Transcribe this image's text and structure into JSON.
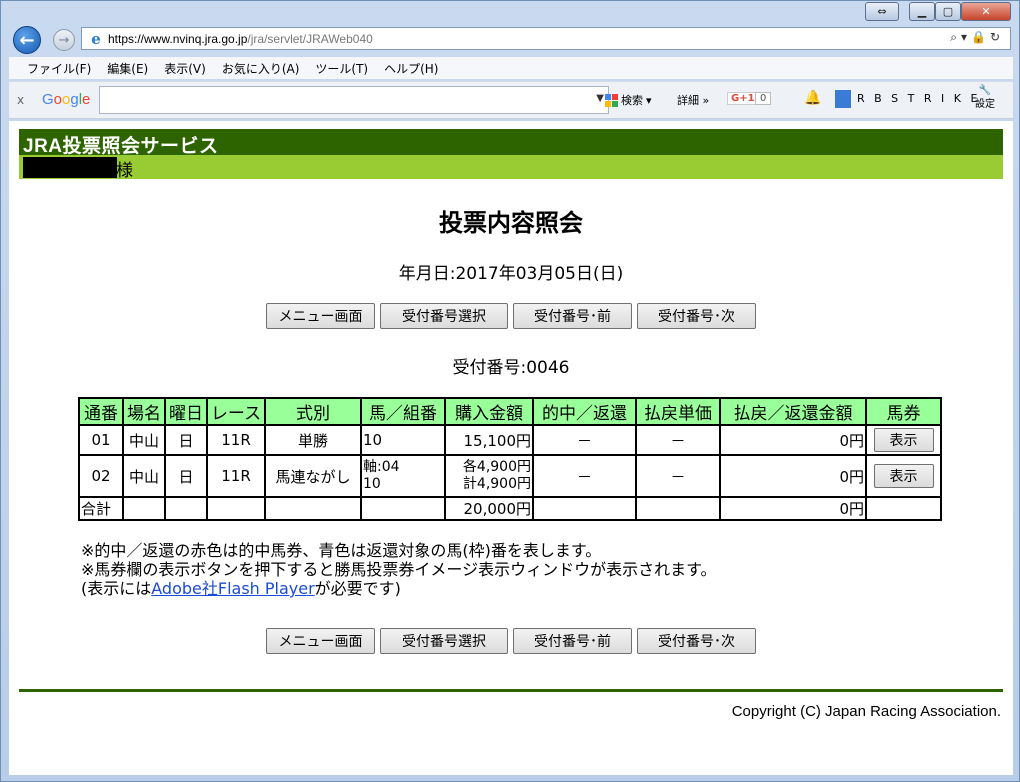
{
  "browser": {
    "url_main": "https://www.nvinq.jra.go.jp",
    "url_path": "/jra/servlet/JRAWeb040",
    "menu": [
      "ファイル(F)",
      "編集(E)",
      "表示(V)",
      "お気に入り(A)",
      "ツール(T)",
      "ヘルプ(H)"
    ],
    "toolbar": {
      "close": "x",
      "search_label": "検索",
      "detail_label": "詳細 »",
      "gplus_label": "G+1",
      "gplus_count": "0",
      "user_label": "R B S T R I K E",
      "settings_label": "設定"
    }
  },
  "header": {
    "service_title": "JRA投票照会サービス",
    "user_suffix": "様"
  },
  "page": {
    "title": "投票内容照会",
    "date_line": "年月日:2017年03月05日(日)",
    "receipt_line": "受付番号:0046"
  },
  "buttons": {
    "menu": "メニュー画面",
    "select": "受付番号選択",
    "prev": "受付番号･前",
    "next": "受付番号･次"
  },
  "table": {
    "headers": [
      "通番",
      "場名",
      "曜日",
      "レース",
      "式別",
      "馬／組番",
      "購入金額",
      "的中／返還",
      "払戻単価",
      "払戻／返還金額",
      "馬券"
    ],
    "rows": [
      {
        "no": "01",
        "venue": "中山",
        "day": "日",
        "race": "11R",
        "type": "単勝",
        "combo1": "10",
        "combo2": "",
        "amount1": "15,100円",
        "amount2": "",
        "hit": "－",
        "unit": "－",
        "payout": "0円",
        "ticket_btn": "表示"
      },
      {
        "no": "02",
        "venue": "中山",
        "day": "日",
        "race": "11R",
        "type": "馬連ながし",
        "combo1": "軸:04",
        "combo2": "10",
        "amount1": "各4,900円",
        "amount2": "計4,900円",
        "hit": "－",
        "unit": "－",
        "payout": "0円",
        "ticket_btn": "表示"
      }
    ],
    "total": {
      "label": "合計",
      "amount": "20,000円",
      "payout": "0円"
    }
  },
  "notes": {
    "line1": "※的中／返還の赤色は的中馬券、青色は返還対象の馬(枠)番を表します。",
    "line2": "※馬券欄の表示ボタンを押下すると勝馬投票券イメージ表示ウィンドウが表示されます。",
    "line3_pre": "(表示には",
    "line3_link": "Adobe社Flash Player",
    "line3_post": "が必要です)"
  },
  "footer": {
    "copyright": "Copyright (C) Japan Racing Association."
  },
  "colors": {
    "header_green": "#2e6400",
    "band_green": "#99cc33",
    "table_header_green": "#99ff99",
    "link_blue": "#1a4bd6"
  }
}
